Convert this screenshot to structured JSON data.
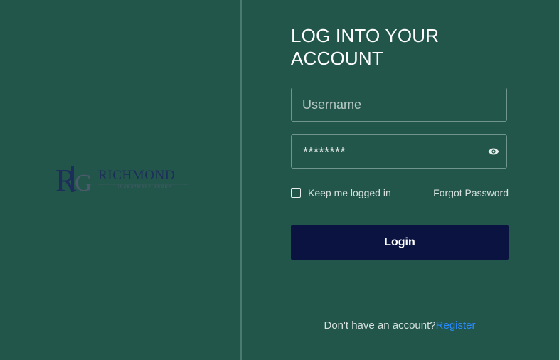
{
  "brand": {
    "logo_monogram": "RIG",
    "logo_name": "RICHMOND",
    "logo_tagline": "INVESTMENT GROUP"
  },
  "login": {
    "title": "LOG INTO YOUR ACCOUNT",
    "username_placeholder": "Username",
    "password_mask": "********",
    "password_toggle_icon": "eye-icon",
    "remember_label": "Keep me logged in",
    "remember_checked": false,
    "forgot_label": "Forgot Password",
    "submit_label": "Login",
    "register_prompt": "Don't have an account?",
    "register_link": "Register"
  },
  "colors": {
    "background": "#22564b",
    "button": "#0b1340",
    "link": "#2a8bff",
    "logo_navy": "#1d2e5a"
  }
}
